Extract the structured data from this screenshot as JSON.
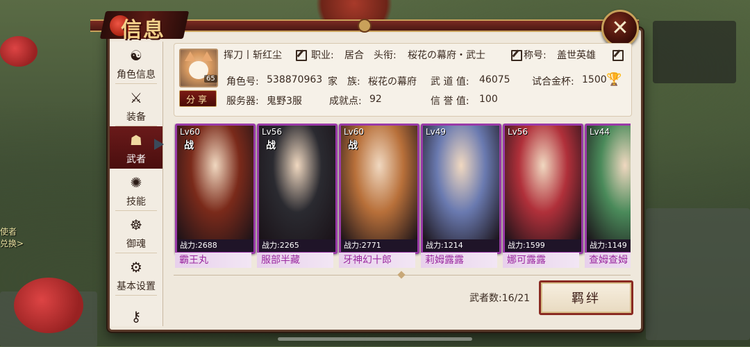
{
  "window": {
    "title": "信息",
    "close_icon": "close-icon"
  },
  "sidebar": {
    "items": [
      {
        "label": "角色信息",
        "icon": "character-icon",
        "glyph": "☯",
        "active": false
      },
      {
        "label": "装备",
        "icon": "swords-icon",
        "glyph": "⚔",
        "active": false
      },
      {
        "label": "武者",
        "icon": "warrior-icon",
        "glyph": "☗",
        "active": true
      },
      {
        "label": "技能",
        "icon": "skill-icon",
        "glyph": "✺",
        "active": false
      },
      {
        "label": "御魂",
        "icon": "soul-icon",
        "glyph": "☸",
        "active": false
      },
      {
        "label": "基本设置",
        "icon": "gear-icon",
        "glyph": "⚙",
        "active": false
      },
      {
        "label": "",
        "icon": "key-icon",
        "glyph": "⚷",
        "active": false
      }
    ]
  },
  "profile": {
    "avatar_level": "65",
    "share_label": "分享",
    "name": "挥刀丨斩红尘",
    "job_label": "职业:",
    "job_value": "居合",
    "rank_label": "头衔:",
    "rank_value": "桜花の幕府・武士",
    "title_label": "称号:",
    "title_value": "盖世英雄",
    "role_id_label": "角色号:",
    "role_id_value": "538870963",
    "clan_label": "家　族:",
    "clan_value": "桜花の幕府",
    "budo_label": "武 道 值:",
    "budo_value": "46075",
    "cup_label": "试合金杯:",
    "cup_value": "1500",
    "server_label": "服务器:",
    "server_value": "鬼野3服",
    "achieve_label": "成就点:",
    "achieve_value": "92",
    "honor_label": "信 誉 值:",
    "honor_value": "100"
  },
  "warriors": [
    {
      "level": "Lv60",
      "battle_mark": "战",
      "power": "战力:2688",
      "name": "霸王丸",
      "color": "#7a2a1a"
    },
    {
      "level": "Lv56",
      "battle_mark": "战",
      "power": "战力:2265",
      "name": "服部半藏",
      "color": "#2a2a30"
    },
    {
      "level": "Lv60",
      "battle_mark": "战",
      "power": "战力:2771",
      "name": "牙神幻十郎",
      "color": "#b8703a"
    },
    {
      "level": "Lv49",
      "battle_mark": "",
      "power": "战力:1214",
      "name": "莉姆露露",
      "color": "#6a7ab0"
    },
    {
      "level": "Lv56",
      "battle_mark": "",
      "power": "战力:1599",
      "name": "娜可露露",
      "color": "#b0303a"
    },
    {
      "level": "Lv44",
      "battle_mark": "",
      "power": "战力:1149",
      "name": "查姆查姆",
      "color": "#4a8a5a"
    }
  ],
  "footer": {
    "count_label": "武者数:16/21",
    "bond_label": "羁绊"
  }
}
